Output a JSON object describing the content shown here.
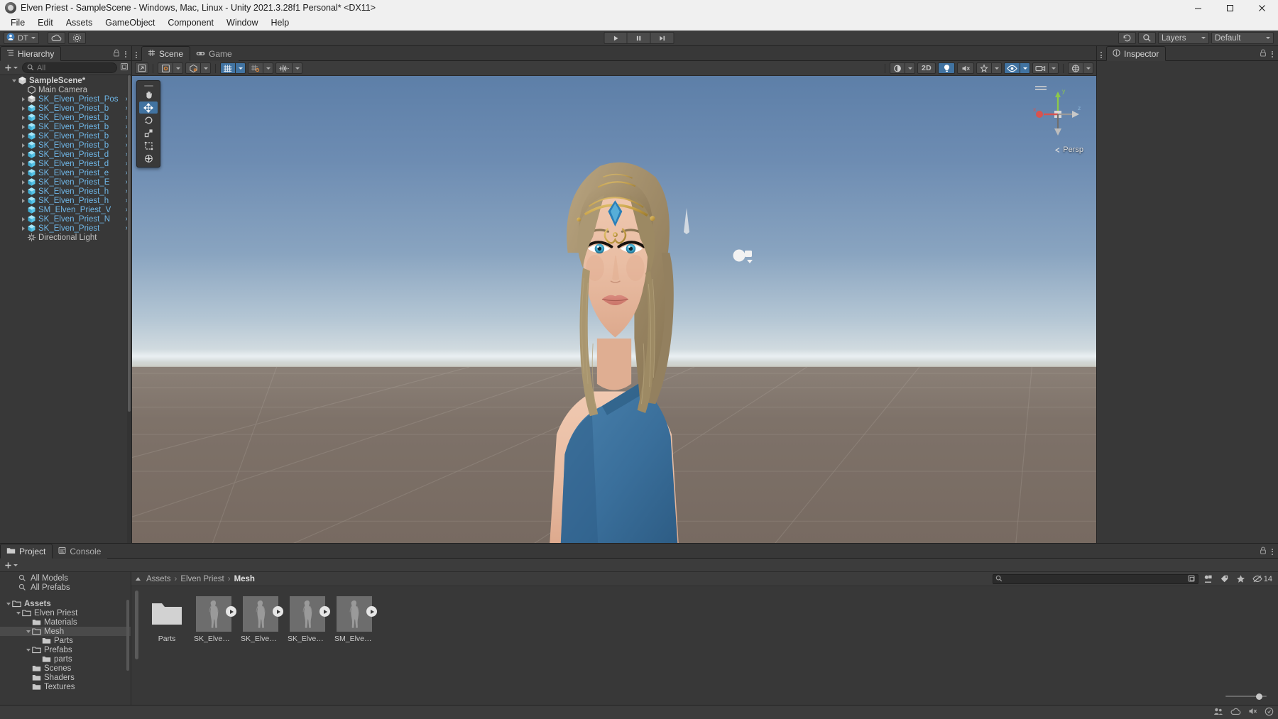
{
  "window": {
    "title": "Elven Priest - SampleScene - Windows, Mac, Linux - Unity 2021.3.28f1 Personal* <DX11>",
    "minimize_label": "Minimize",
    "maximize_label": "Maximize",
    "close_label": "Close"
  },
  "menubar": {
    "items": [
      {
        "label": "File"
      },
      {
        "label": "Edit"
      },
      {
        "label": "Assets"
      },
      {
        "label": "GameObject"
      },
      {
        "label": "Component"
      },
      {
        "label": "Window"
      },
      {
        "label": "Help"
      }
    ]
  },
  "toolbar": {
    "account_label": "DT",
    "cloud_icon": "cloud-icon",
    "settings_icon": "gear-icon",
    "play_icon": "play-icon",
    "pause_icon": "pause-icon",
    "step_icon": "step-icon",
    "undo_history_icon": "undo-history-icon",
    "search_icon": "search-icon",
    "layers_label": "Layers",
    "layout_label": "Default"
  },
  "hierarchy": {
    "tab_label": "Hierarchy",
    "lock_icon": "lock-icon",
    "menu_icon": "kebab-icon",
    "add_label": "+",
    "search_placeholder": "All",
    "rows": [
      {
        "label": "SampleScene*",
        "depth": 0,
        "icon": "scene-icon",
        "kind": "scene",
        "twisty": "open"
      },
      {
        "label": "Main Camera",
        "depth": 1,
        "icon": "gameobject-icon",
        "kind": "plain",
        "twisty": "none"
      },
      {
        "label": "SK_Elven_Priest_Pos",
        "depth": 1,
        "icon": "prefab-variant-icon",
        "kind": "prefab",
        "twisty": "closed"
      },
      {
        "label": "SK_Elven_Priest_b",
        "depth": 1,
        "icon": "prefab-icon",
        "kind": "prefab",
        "twisty": "closed"
      },
      {
        "label": "SK_Elven_Priest_b",
        "depth": 1,
        "icon": "prefab-icon",
        "kind": "prefab",
        "twisty": "closed"
      },
      {
        "label": "SK_Elven_Priest_b",
        "depth": 1,
        "icon": "prefab-icon",
        "kind": "prefab",
        "twisty": "closed"
      },
      {
        "label": "SK_Elven_Priest_b",
        "depth": 1,
        "icon": "prefab-icon",
        "kind": "prefab",
        "twisty": "closed"
      },
      {
        "label": "SK_Elven_Priest_b",
        "depth": 1,
        "icon": "prefab-icon",
        "kind": "prefab",
        "twisty": "closed"
      },
      {
        "label": "SK_Elven_Priest_d",
        "depth": 1,
        "icon": "prefab-icon",
        "kind": "prefab",
        "twisty": "closed"
      },
      {
        "label": "SK_Elven_Priest_d",
        "depth": 1,
        "icon": "prefab-icon",
        "kind": "prefab",
        "twisty": "closed"
      },
      {
        "label": "SK_Elven_Priest_e",
        "depth": 1,
        "icon": "prefab-icon",
        "kind": "prefab",
        "twisty": "closed"
      },
      {
        "label": "SK_Elven_Priest_E",
        "depth": 1,
        "icon": "prefab-icon",
        "kind": "prefab",
        "twisty": "closed"
      },
      {
        "label": "SK_Elven_Priest_h",
        "depth": 1,
        "icon": "prefab-icon",
        "kind": "prefab",
        "twisty": "closed"
      },
      {
        "label": "SK_Elven_Priest_h",
        "depth": 1,
        "icon": "prefab-icon",
        "kind": "prefab",
        "twisty": "closed"
      },
      {
        "label": "SM_Elven_Priest_V",
        "depth": 1,
        "icon": "prefab-icon",
        "kind": "prefab",
        "twisty": "none"
      },
      {
        "label": "SK_Elven_Priest_N",
        "depth": 1,
        "icon": "prefab-icon",
        "kind": "prefab",
        "twisty": "closed"
      },
      {
        "label": "SK_Elven_Priest",
        "depth": 1,
        "icon": "prefab-icon",
        "kind": "prefab",
        "twisty": "closed"
      },
      {
        "label": "Directional Light",
        "depth": 1,
        "icon": "light-icon",
        "kind": "plain",
        "twisty": "none"
      }
    ]
  },
  "scene": {
    "tabs": [
      {
        "label": "Scene",
        "icon": "scene-grid-icon",
        "active": true
      },
      {
        "label": "Game",
        "icon": "gamepad-icon",
        "active": false
      }
    ],
    "menu_icon": "kebab-icon",
    "maximize_icon": "maximize-panel-icon",
    "toolbar": {
      "shading_mode_icon": "shading-mode-icon",
      "draw_mode_icon": "draw-mode-icon",
      "grid_toggle_icon": "grid-icon",
      "snap_icon": "snap-increment-icon",
      "audio_icon": "audio-waveform-icon",
      "gizmos_label": "Gizmos",
      "fx_icon": "fx-icon",
      "twod_label": "2D",
      "light_icon": "lightbulb-icon",
      "audio_mute_icon": "audio-mute-icon",
      "effects_icon": "effects-icon",
      "scene_visibility_icon": "eye-icon",
      "camera_icon": "scene-camera-icon",
      "gizmos_icon": "gizmos-icon"
    },
    "tools": [
      {
        "name": "hand-tool",
        "icon": "hand-icon",
        "active": false
      },
      {
        "name": "move-tool",
        "icon": "move-arrows-icon",
        "active": true
      },
      {
        "name": "rotate-tool",
        "icon": "rotate-icon",
        "active": false
      },
      {
        "name": "scale-tool",
        "icon": "scale-icon",
        "active": false
      },
      {
        "name": "rect-tool",
        "icon": "rect-transform-icon",
        "active": false
      },
      {
        "name": "transform-tool",
        "icon": "combined-transform-icon",
        "active": false
      }
    ],
    "gizmo": {
      "x_label": "x",
      "y_label": "y",
      "z_label": "z",
      "perspective_label": "Persp"
    },
    "colors": {
      "sky_top": "#5d7fa8",
      "sky_horizon": "#d7dfe2",
      "ground": "#7c7067",
      "accent_blue": "#4173a1",
      "dress_blue": "#3c72a0",
      "skin": "#e8bca4",
      "hair": "#a4916f",
      "gold": "#c9a34a",
      "gem_blue": "#2a7fb8"
    }
  },
  "inspector": {
    "tab_label": "Inspector",
    "info_icon": "info-icon",
    "lock_icon": "lock-icon",
    "menu_icon": "kebab-icon"
  },
  "project": {
    "tabs": [
      {
        "label": "Project",
        "icon": "folder-icon",
        "active": true
      },
      {
        "label": "Console",
        "icon": "console-icon",
        "active": false
      }
    ],
    "add_label": "+",
    "lock_icon": "lock-icon",
    "menu_icon": "kebab-icon",
    "favorites": [
      {
        "label": "All Models",
        "icon": "search-icon"
      },
      {
        "label": "All Prefabs",
        "icon": "search-icon"
      }
    ],
    "tree": [
      {
        "label": "Assets",
        "depth": 0,
        "twisty": "open",
        "bold": true,
        "selected": false
      },
      {
        "label": "Elven Priest",
        "depth": 1,
        "twisty": "open",
        "bold": false,
        "selected": false
      },
      {
        "label": "Materials",
        "depth": 2,
        "twisty": "none",
        "bold": false,
        "selected": false
      },
      {
        "label": "Mesh",
        "depth": 2,
        "twisty": "open",
        "bold": false,
        "selected": true
      },
      {
        "label": "Parts",
        "depth": 3,
        "twisty": "none",
        "bold": false,
        "selected": false
      },
      {
        "label": "Prefabs",
        "depth": 2,
        "twisty": "open",
        "bold": false,
        "selected": false
      },
      {
        "label": "parts",
        "depth": 3,
        "twisty": "none",
        "bold": false,
        "selected": false
      },
      {
        "label": "Scenes",
        "depth": 2,
        "twisty": "none",
        "bold": false,
        "selected": false
      },
      {
        "label": "Shaders",
        "depth": 2,
        "twisty": "none",
        "bold": false,
        "selected": false
      },
      {
        "label": "Textures",
        "depth": 2,
        "twisty": "none",
        "bold": false,
        "selected": false
      }
    ],
    "breadcrumb": [
      {
        "label": "Assets",
        "last": false
      },
      {
        "label": "Elven Priest",
        "last": false
      },
      {
        "label": "Mesh",
        "last": true
      }
    ],
    "search_placeholder": "",
    "header_icons": [
      {
        "name": "search-by-type-icon"
      },
      {
        "name": "search-by-label-icon"
      },
      {
        "name": "favorite-star-icon"
      }
    ],
    "hidden_count": "14",
    "hidden_icon": "eye-off-icon",
    "assets": [
      {
        "label": "Parts",
        "type": "folder",
        "has_play": false
      },
      {
        "label": "SK_Elven_...",
        "type": "model",
        "has_play": true
      },
      {
        "label": "SK_Elven_...",
        "type": "model",
        "has_play": true
      },
      {
        "label": "SK_Elven_...",
        "type": "model",
        "has_play": true
      },
      {
        "label": "SM_Elven_...",
        "type": "model",
        "has_play": true
      }
    ],
    "zoom_label": "thumbnail-size-slider"
  },
  "statusbar": {
    "icons": [
      {
        "name": "collab-icon"
      },
      {
        "name": "cloud-status-icon"
      },
      {
        "name": "mute-audio-icon"
      },
      {
        "name": "notification-icon"
      }
    ]
  }
}
